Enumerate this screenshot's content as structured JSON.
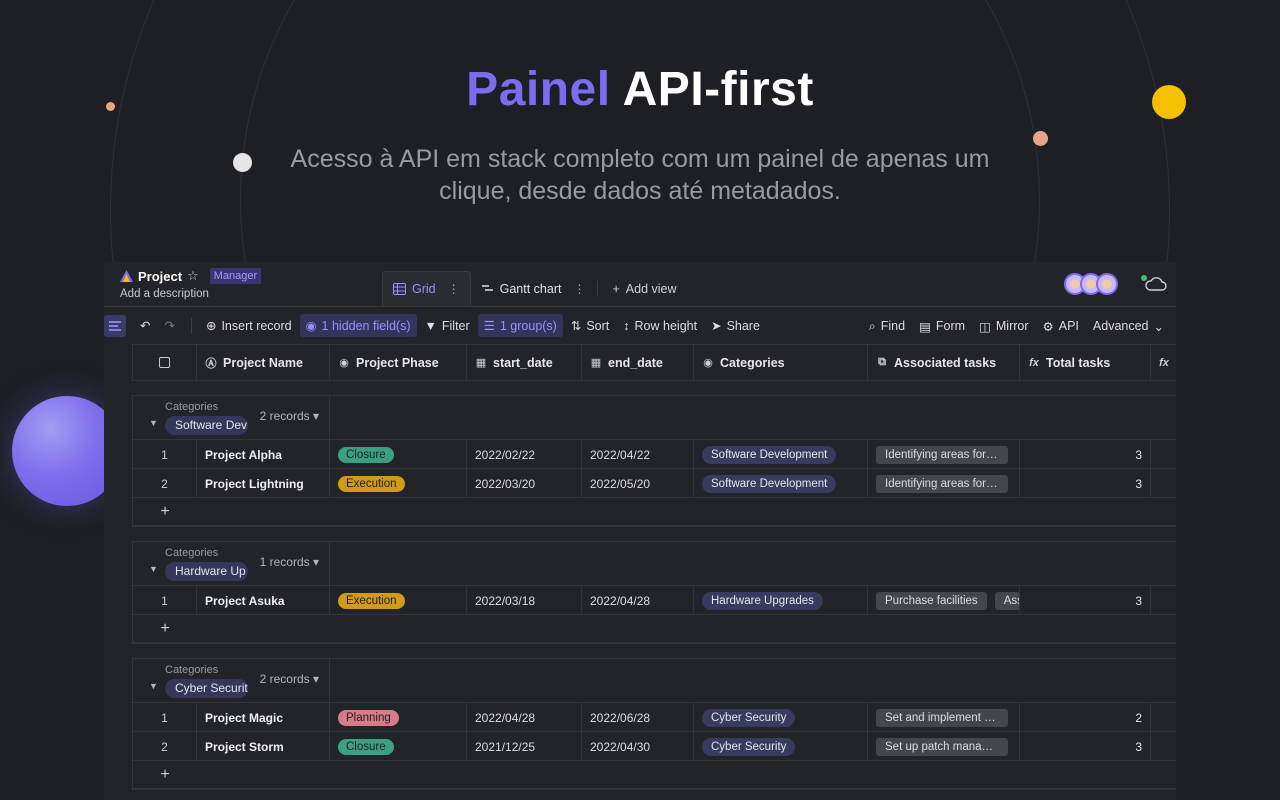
{
  "hero": {
    "title_accent": "Painel",
    "title_rest": "API-first",
    "subtitle": "Acesso à API em stack completo com um painel de apenas um clique, desde dados até metadados."
  },
  "project": {
    "name": "Project",
    "role": "Manager",
    "description": "Add a description"
  },
  "views": {
    "grid_label": "Grid",
    "gantt_label": "Gantt chart",
    "add_view_label": "Add view"
  },
  "toolbar": {
    "insert_record": "Insert record",
    "hidden_fields": "1 hidden field(s)",
    "filter": "Filter",
    "group": "1 group(s)",
    "sort": "Sort",
    "row_height": "Row height",
    "share": "Share",
    "find": "Find",
    "form": "Form",
    "mirror": "Mirror",
    "api": "API",
    "advanced": "Advanced"
  },
  "columns": [
    "Project Name",
    "Project Phase",
    "start_date",
    "end_date",
    "Categories",
    "Associated tasks",
    "Total tasks"
  ],
  "group_label": "Categories",
  "groups": [
    {
      "value": "Software Dev",
      "count": "2 records",
      "rows": [
        {
          "n": "1",
          "name": "Project Alpha",
          "phase": "Closure",
          "start": "2022/02/22",
          "end": "2022/04/22",
          "category": "Software Development",
          "tasks": [
            "Identifying areas for improvement"
          ],
          "total": "3"
        },
        {
          "n": "2",
          "name": "Project Lightning",
          "phase": "Execution",
          "start": "2022/03/20",
          "end": "2022/05/20",
          "category": "Software Development",
          "tasks": [
            "Identifying areas for improvement"
          ],
          "total": "3"
        }
      ]
    },
    {
      "value": "Hardware Up",
      "count": "1 records",
      "rows": [
        {
          "n": "1",
          "name": "Project Asuka",
          "phase": "Execution",
          "start": "2022/03/18",
          "end": "2022/04/28",
          "category": "Hardware Upgrades",
          "tasks": [
            "Purchase facilities",
            "Assemble"
          ],
          "total": "3"
        }
      ]
    },
    {
      "value": "Cyber Securit",
      "count": "2 records",
      "rows": [
        {
          "n": "1",
          "name": "Project Magic",
          "phase": "Planning",
          "start": "2022/04/28",
          "end": "2022/06/28",
          "category": "Cyber Security",
          "tasks": [
            "Set and implement u..."
          ],
          "total": "2"
        },
        {
          "n": "2",
          "name": "Project Storm",
          "phase": "Closure",
          "start": "2021/12/25",
          "end": "2022/04/30",
          "category": "Cyber Security",
          "tasks": [
            "Set up patch management"
          ],
          "total": "3"
        }
      ]
    }
  ],
  "add_row_symbol": "+",
  "phase_colors": {
    "Closure": "#3aa080",
    "Execution": "#d19a1d",
    "Planning": "#d67b8a"
  },
  "colors": {
    "accent": "#7c6cf0",
    "background": "#1e1f24",
    "panel": "#232429"
  }
}
